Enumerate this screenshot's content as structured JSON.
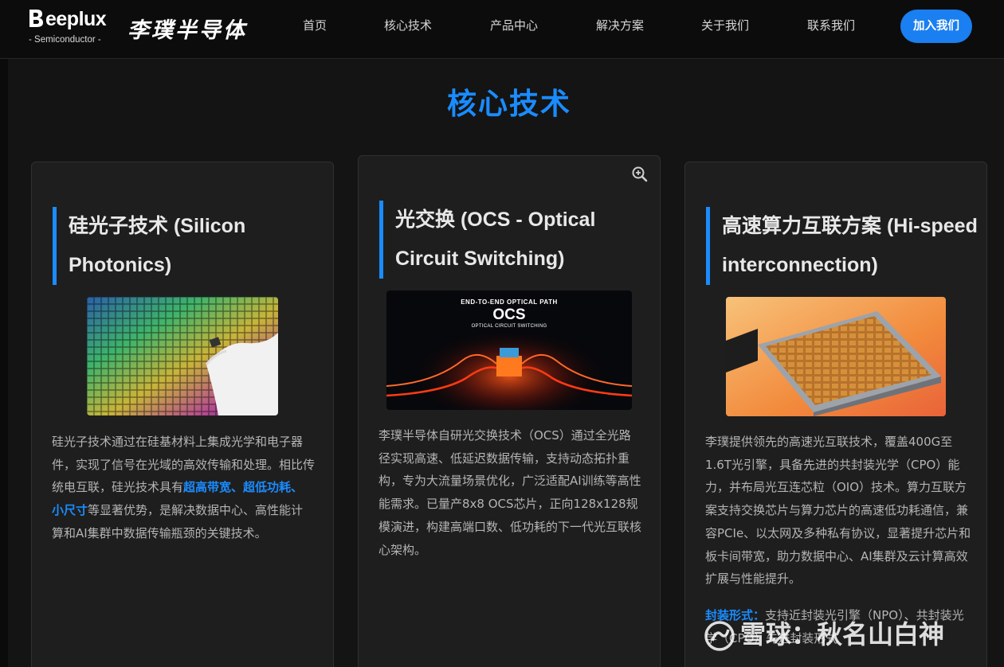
{
  "brand": {
    "logo_word": "eeplux",
    "logo_sub": "- Semiconductor -",
    "name_cn": "李璞半导体"
  },
  "nav": {
    "items": [
      "首页",
      "核心技术",
      "产品中心",
      "解决方案",
      "关于我们",
      "联系我们"
    ],
    "join_label": "加入我们"
  },
  "colors": {
    "accent": "#1a8cff",
    "button": "#1a7ff0",
    "background": "#141414",
    "card": "#1e1e1e"
  },
  "section": {
    "title": "核心技术"
  },
  "cards": [
    {
      "title": "硅光子技术 (Silicon Photonics)",
      "image_alt": "silicon-wafer-photo",
      "text_a": "硅光子技术通过在硅基材料上集成光学和电子器件，实现了信号在光域的高效传输和处理。相比传统电互联，硅光技术具有",
      "text_hl": "超高带宽、超低功耗、小尺寸",
      "text_b": "等显著优势，是解决数据中心、高性能计算和AI集群中数据传输瓶颈的关键技术。"
    },
    {
      "title": "光交换 (OCS - Optical Circuit Switching)",
      "image_caption_top": "END-TO-END OPTICAL PATH",
      "image_caption_main": "OCS",
      "image_caption_sub": "OPTICAL CIRCUIT SWITCHING",
      "text": "李璞半导体自研光交换技术（OCS）通过全光路径实现高速、低延迟数据传输，支持动态拓扑重构，专为大流量场景优化，广泛适配AI训练等高性能需求。已量产8x8 OCS芯片，正向128x128规模演进，构建高端口数、低功耗的下一代光互联核心架构。"
    },
    {
      "title": "高速算力互联方案 (Hi-speed interconnection)",
      "image_alt": "chip-package-photo",
      "text": "李璞提供领先的高速光互联技术，覆盖400G至1.6T光引擎，具备先进的共封装光学（CPO）能力，并布局光互连芯粒（OIO）技术。算力互联方案支持交换芯片与算力芯片的高速低功耗通信，兼容PCIe、以太网及多种私有协议，显著提升芯片和板卡间带宽，助力数据中心、AI集群及云计算高效扩展与性能提升。",
      "package_label": "封装形式：",
      "package_text": "支持近封装光引擎（NPO）、共封装光学（CPO）先进封装形式"
    }
  ],
  "watermark": {
    "text": "雪球：秋名山白神"
  }
}
